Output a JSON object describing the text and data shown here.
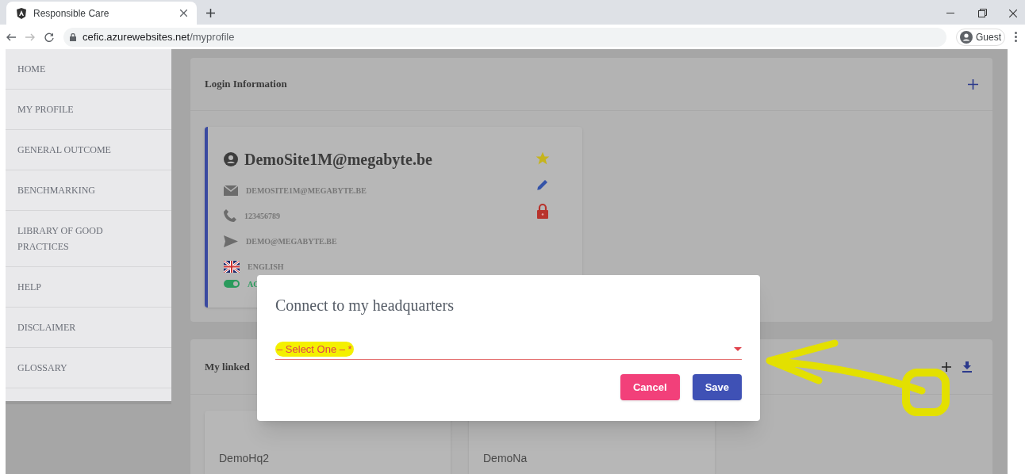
{
  "browser": {
    "tab_title": "Responsible Care",
    "url_host": "cefic.azurewebsites.net",
    "url_path": "/myprofile",
    "profile": "Guest"
  },
  "sidebar": {
    "items": [
      {
        "label": "HOME"
      },
      {
        "label": "MY PROFILE"
      },
      {
        "label": "GENERAL OUTCOME"
      },
      {
        "label": "BENCHMARKING"
      },
      {
        "label": "LIBRARY OF GOOD PRACTICES"
      },
      {
        "label": "HELP"
      },
      {
        "label": "DISCLAIMER"
      },
      {
        "label": "GLOSSARY"
      }
    ]
  },
  "login_panel": {
    "title": "Login Information",
    "card": {
      "name": "DemoSite1M@megabyte.be",
      "rows": [
        {
          "kind": "email",
          "text": "DEMOSITE1M@MEGABYTE.BE"
        },
        {
          "kind": "phone",
          "text": "123456789"
        },
        {
          "kind": "send",
          "text": "DEMO@MEGABYTE.BE"
        },
        {
          "kind": "flag",
          "text": "ENGLISH"
        },
        {
          "kind": "toggle",
          "text": "AC",
          "on": true
        }
      ]
    }
  },
  "linked_panel": {
    "title": "My linked",
    "cards": [
      {
        "name": "DemoHq2"
      },
      {
        "name": "DemoNa"
      }
    ]
  },
  "dialog": {
    "title": "Connect to my headquarters",
    "select": {
      "placeholder": "– Select One – *",
      "invalid": true
    },
    "buttons": [
      {
        "kind": "cancel",
        "label": "Cancel"
      },
      {
        "kind": "save",
        "label": "Save"
      }
    ]
  }
}
